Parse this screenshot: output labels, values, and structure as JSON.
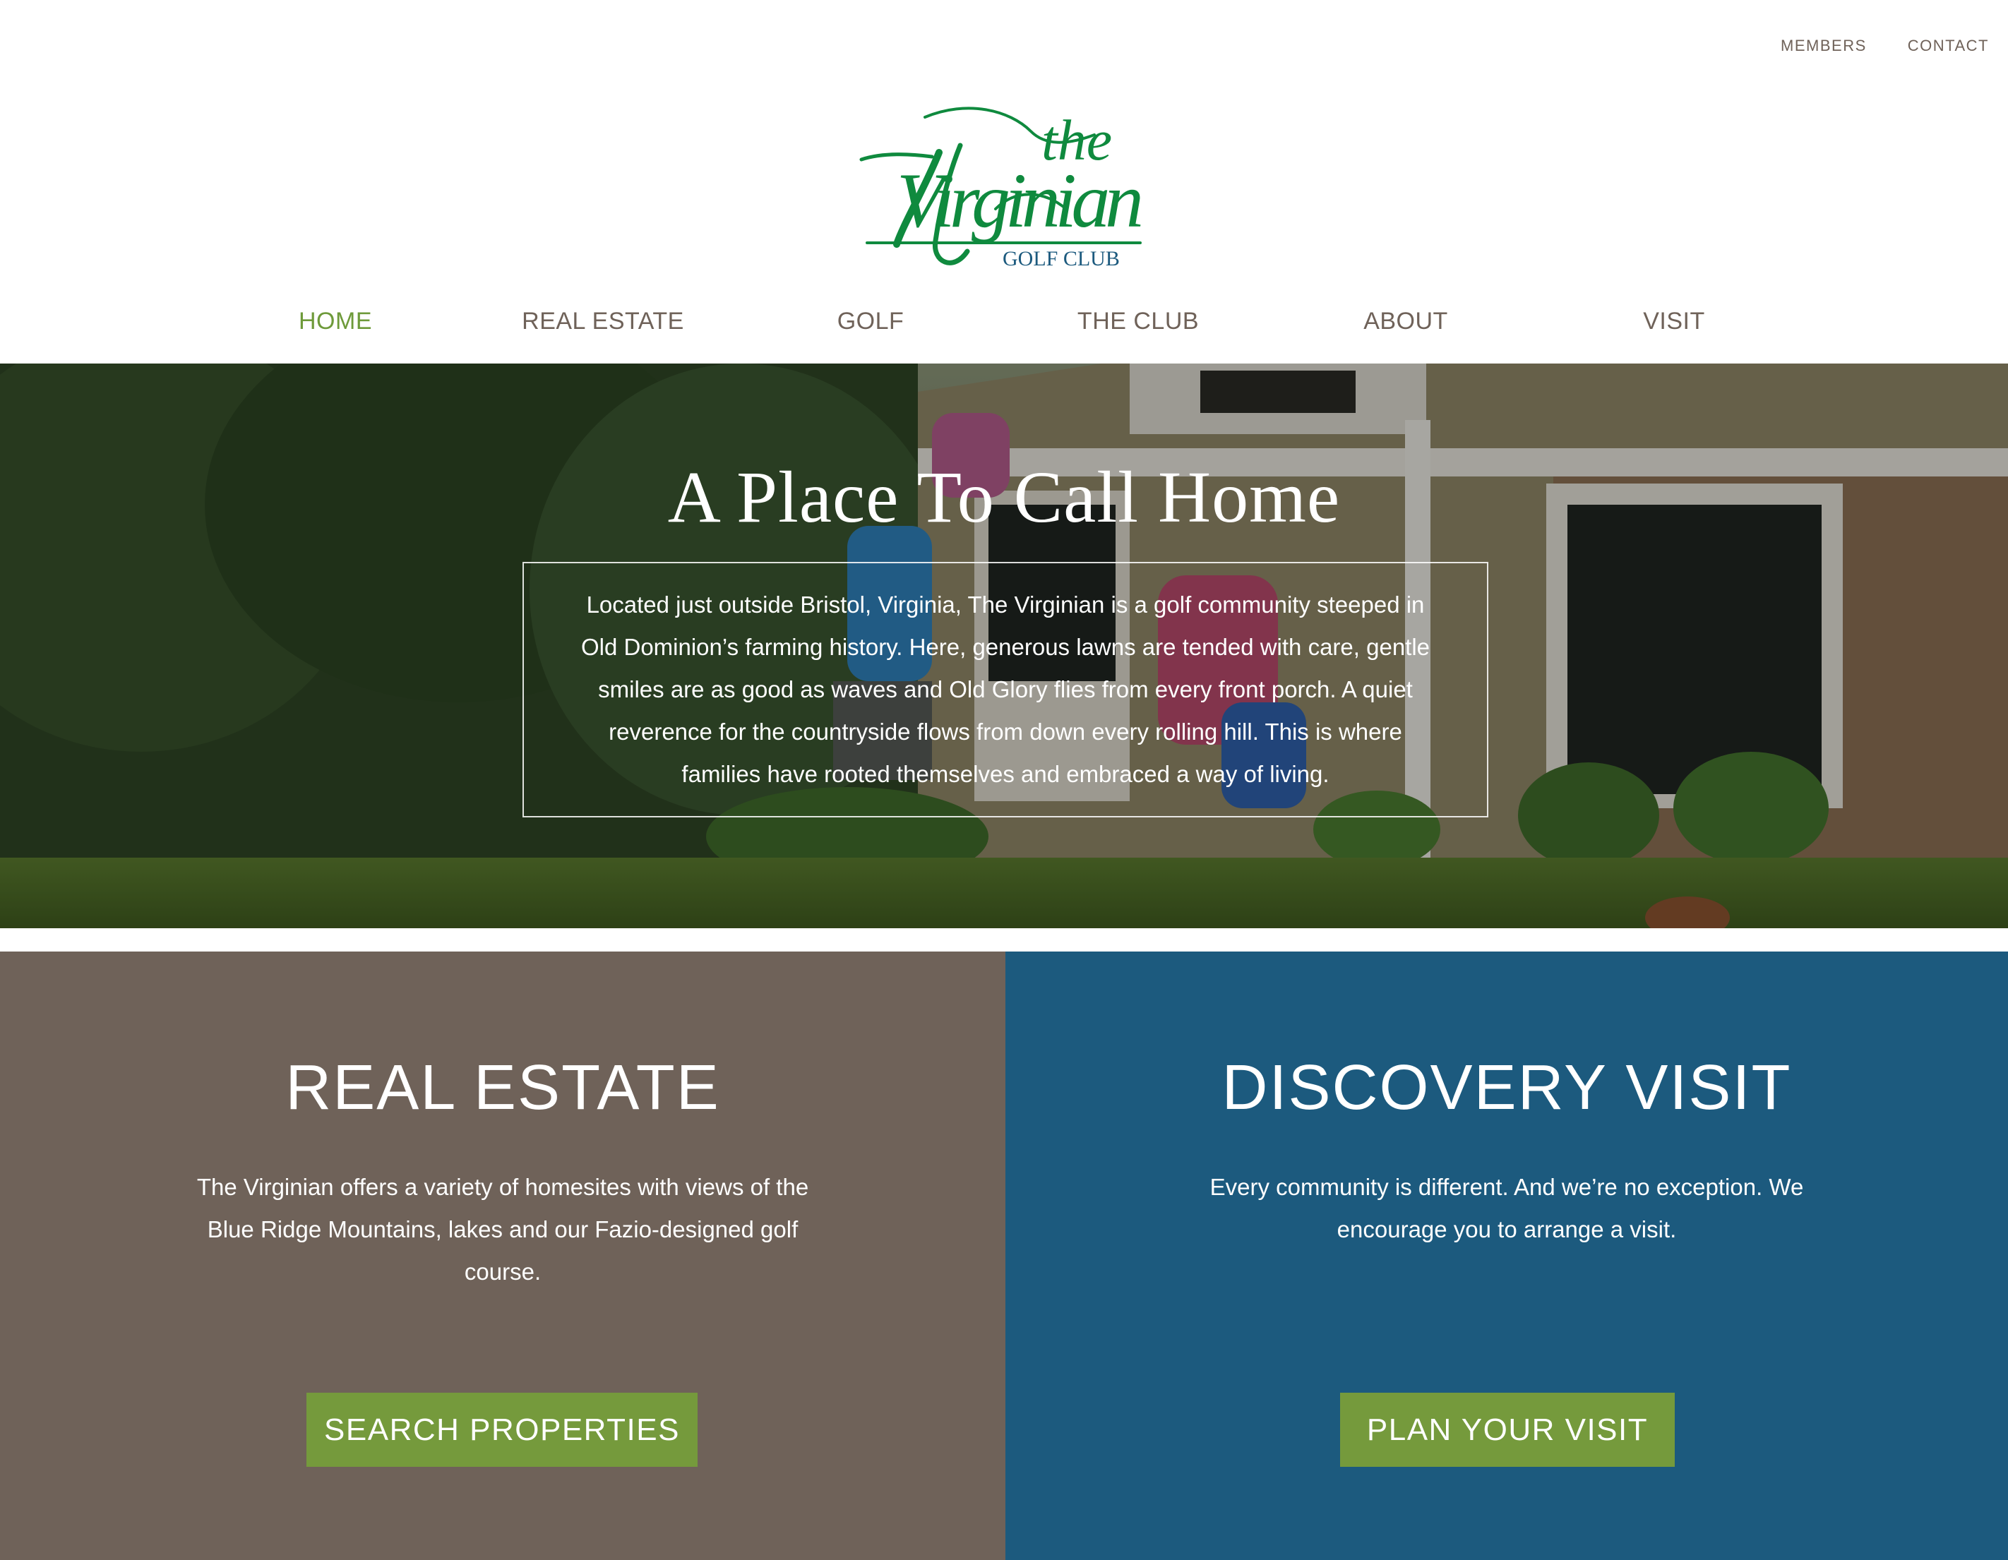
{
  "utility_nav": {
    "members": "MEMBERS",
    "contact": "CONTACT"
  },
  "logo": {
    "text_script_top": "the",
    "text_script_main": "Virginian",
    "text_sub": "GOLF CLUB",
    "color": "#0f8a3e"
  },
  "main_nav": [
    {
      "label": "HOME",
      "active": true
    },
    {
      "label": "REAL ESTATE",
      "active": false
    },
    {
      "label": "GOLF",
      "active": false
    },
    {
      "label": "THE CLUB",
      "active": false
    },
    {
      "label": "ABOUT",
      "active": false
    },
    {
      "label": "VISIT",
      "active": false
    }
  ],
  "hero": {
    "title": "A Place To Call Home",
    "body": "Located just outside Bristol, Virginia, The Virginian is a golf community steeped in Old Dominion’s farming history. Here, generous lawns are tended with care, gentle smiles are as good as waves and Old Glory flies from every front porch. A quiet reverence for the countryside flows from down every rolling hill. This is where families have rooted themselves and embraced a way of living."
  },
  "real_estate": {
    "heading": "REAL ESTATE",
    "body": "The Virginian offers a variety of homesites with views of the Blue Ridge Mountains, lakes and our Fazio-designed golf course.",
    "button": "SEARCH PROPERTIES",
    "bg_color": "#6f6259"
  },
  "discovery": {
    "heading": "DISCOVERY VISIT",
    "body": "Every community is different. And we’re no exception. We encourage you to arrange a visit.",
    "button": "PLAN YOUR VISIT",
    "bg_color": "#1c5a7e"
  },
  "colors": {
    "accent_green": "#759a3c",
    "nav_text": "#6f6259",
    "nav_active": "#6e9a3a"
  }
}
